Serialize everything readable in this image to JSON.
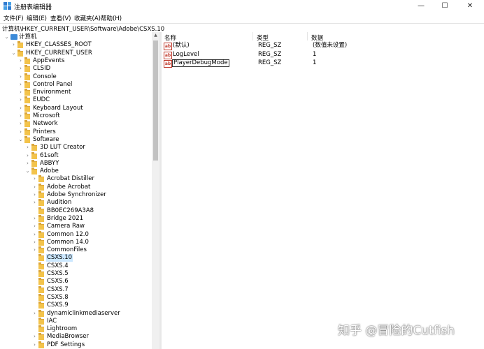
{
  "window": {
    "title": "注册表编辑器",
    "minimize_glyph": "—",
    "maximize_glyph": "☐",
    "close_glyph": "✕"
  },
  "menu": [
    "文件(F)",
    "编辑(E)",
    "查看(V)",
    "收藏夹(A)",
    "帮助(H)"
  ],
  "address": "计算机\\HKEY_CURRENT_USER\\Software\\Adobe\\CSXS.10",
  "tree": [
    {
      "label": "计算机",
      "depth": 0,
      "state": "expanded",
      "icon": "pc"
    },
    {
      "label": "HKEY_CLASSES_ROOT",
      "depth": 1,
      "state": "collapsed",
      "icon": "folder"
    },
    {
      "label": "HKEY_CURRENT_USER",
      "depth": 1,
      "state": "expanded",
      "icon": "folder"
    },
    {
      "label": "AppEvents",
      "depth": 2,
      "state": "collapsed",
      "icon": "folder"
    },
    {
      "label": "CLSID",
      "depth": 2,
      "state": "collapsed",
      "icon": "folder"
    },
    {
      "label": "Console",
      "depth": 2,
      "state": "collapsed",
      "icon": "folder"
    },
    {
      "label": "Control Panel",
      "depth": 2,
      "state": "collapsed",
      "icon": "folder"
    },
    {
      "label": "Environment",
      "depth": 2,
      "state": "collapsed",
      "icon": "folder"
    },
    {
      "label": "EUDC",
      "depth": 2,
      "state": "collapsed",
      "icon": "folder"
    },
    {
      "label": "Keyboard Layout",
      "depth": 2,
      "state": "collapsed",
      "icon": "folder"
    },
    {
      "label": "Microsoft",
      "depth": 2,
      "state": "collapsed",
      "icon": "folder"
    },
    {
      "label": "Network",
      "depth": 2,
      "state": "collapsed",
      "icon": "folder"
    },
    {
      "label": "Printers",
      "depth": 2,
      "state": "collapsed",
      "icon": "folder"
    },
    {
      "label": "Software",
      "depth": 2,
      "state": "expanded",
      "icon": "folder"
    },
    {
      "label": "3D LUT Creator",
      "depth": 3,
      "state": "collapsed",
      "icon": "folder"
    },
    {
      "label": "61soft",
      "depth": 3,
      "state": "collapsed",
      "icon": "folder"
    },
    {
      "label": "ABBYY",
      "depth": 3,
      "state": "collapsed",
      "icon": "folder"
    },
    {
      "label": "Adobe",
      "depth": 3,
      "state": "expanded",
      "icon": "folder"
    },
    {
      "label": "Acrobat Distiller",
      "depth": 4,
      "state": "collapsed",
      "icon": "folder"
    },
    {
      "label": "Adobe Acrobat",
      "depth": 4,
      "state": "collapsed",
      "icon": "folder"
    },
    {
      "label": "Adobe Synchronizer",
      "depth": 4,
      "state": "collapsed",
      "icon": "folder"
    },
    {
      "label": "Audition",
      "depth": 4,
      "state": "collapsed",
      "icon": "folder"
    },
    {
      "label": "BB0EC269A3A8",
      "depth": 4,
      "state": "leaf",
      "icon": "folder"
    },
    {
      "label": "Bridge 2021",
      "depth": 4,
      "state": "collapsed",
      "icon": "folder"
    },
    {
      "label": "Camera Raw",
      "depth": 4,
      "state": "collapsed",
      "icon": "folder"
    },
    {
      "label": "Common 12.0",
      "depth": 4,
      "state": "collapsed",
      "icon": "folder"
    },
    {
      "label": "Common 14.0",
      "depth": 4,
      "state": "collapsed",
      "icon": "folder"
    },
    {
      "label": "CommonFiles",
      "depth": 4,
      "state": "collapsed",
      "icon": "folder"
    },
    {
      "label": "CSXS.10",
      "depth": 4,
      "state": "leaf",
      "icon": "folder",
      "selected": true
    },
    {
      "label": "CSXS.4",
      "depth": 4,
      "state": "leaf",
      "icon": "folder"
    },
    {
      "label": "CSXS.5",
      "depth": 4,
      "state": "leaf",
      "icon": "folder"
    },
    {
      "label": "CSXS.6",
      "depth": 4,
      "state": "leaf",
      "icon": "folder"
    },
    {
      "label": "CSXS.7",
      "depth": 4,
      "state": "leaf",
      "icon": "folder"
    },
    {
      "label": "CSXS.8",
      "depth": 4,
      "state": "leaf",
      "icon": "folder"
    },
    {
      "label": "CSXS.9",
      "depth": 4,
      "state": "leaf",
      "icon": "folder"
    },
    {
      "label": "dynamiclinkmediaserver",
      "depth": 4,
      "state": "collapsed",
      "icon": "folder"
    },
    {
      "label": "IAC",
      "depth": 4,
      "state": "leaf",
      "icon": "folder"
    },
    {
      "label": "Lightroom",
      "depth": 4,
      "state": "leaf",
      "icon": "folder"
    },
    {
      "label": "MediaBrowser",
      "depth": 4,
      "state": "collapsed",
      "icon": "folder"
    },
    {
      "label": "PDF Settings",
      "depth": 4,
      "state": "collapsed",
      "icon": "folder"
    }
  ],
  "values_table": {
    "headers": {
      "name": "名称",
      "type": "类型",
      "data": "数据"
    },
    "rows": [
      {
        "name": "(默认)",
        "type": "REG_SZ",
        "data": "(数值未设置)"
      },
      {
        "name": "LogLevel",
        "type": "REG_SZ",
        "data": "1"
      },
      {
        "name": "PlayerDebugMode",
        "type": "REG_SZ",
        "data": "1",
        "focused": true
      }
    ]
  },
  "watermark": "知乎 @冒险的Cutfish"
}
